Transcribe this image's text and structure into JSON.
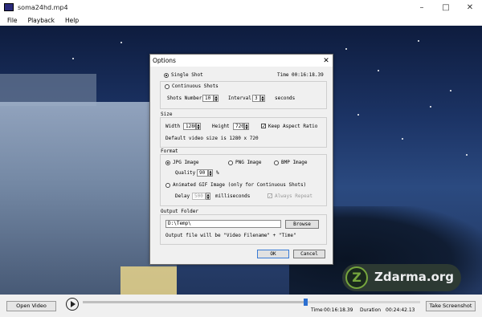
{
  "window": {
    "title": "soma24hd.mp4"
  },
  "menu": {
    "items": [
      "File",
      "Playback",
      "Help"
    ]
  },
  "dialog": {
    "title": "Options",
    "shot": {
      "single_label": "Single Shot",
      "time_label": "Time",
      "time_value": "00:16:18.39",
      "continuous_label": "Continuous Shots",
      "shots_number_label": "Shots Number",
      "shots_number_value": "10",
      "interval_label": "Interval",
      "interval_value": "3",
      "seconds_label": "seconds"
    },
    "size": {
      "group_label": "Size",
      "width_label": "Width",
      "width_value": "1280",
      "height_label": "Height",
      "height_value": "720",
      "keep_aspect_label": "Keep Aspect Ratio",
      "default_size_text": "Default video size is 1280 x 720"
    },
    "format": {
      "group_label": "Format",
      "jpg_label": "JPG Image",
      "png_label": "PNG Image",
      "bmp_label": "BMP Image",
      "quality_label": "Quality",
      "quality_value": "90",
      "percent": "%",
      "gif_label": "Animated GIF Image (only for Continuous Shots)",
      "delay_label": "Delay",
      "delay_value": "500",
      "milliseconds_label": "milliseconds",
      "always_repeat_label": "Always Repeat"
    },
    "output": {
      "group_label": "Output Folder",
      "path_value": "D:\\Temp\\",
      "browse_label": "Browse",
      "filename_text": "Output file will be \"Video Filename\" + \"Time\""
    },
    "ok_label": "OK",
    "cancel_label": "Cancel"
  },
  "player": {
    "open_video_label": "Open Video",
    "time_label": "Time",
    "time_value": "00:16:18.39",
    "duration_label": "Duration",
    "duration_value": "00:24:42.13",
    "progress_fraction": 0.66,
    "take_screenshot_label": "Take Screenshot"
  },
  "watermark": {
    "text": "Zdarma.org",
    "logo_letter": "Z"
  },
  "icons": [
    "app-icon",
    "minimize-icon",
    "maximize-icon",
    "close-icon",
    "dialog-close-icon",
    "play-icon",
    "spin-up-icon",
    "spin-down-icon"
  ]
}
